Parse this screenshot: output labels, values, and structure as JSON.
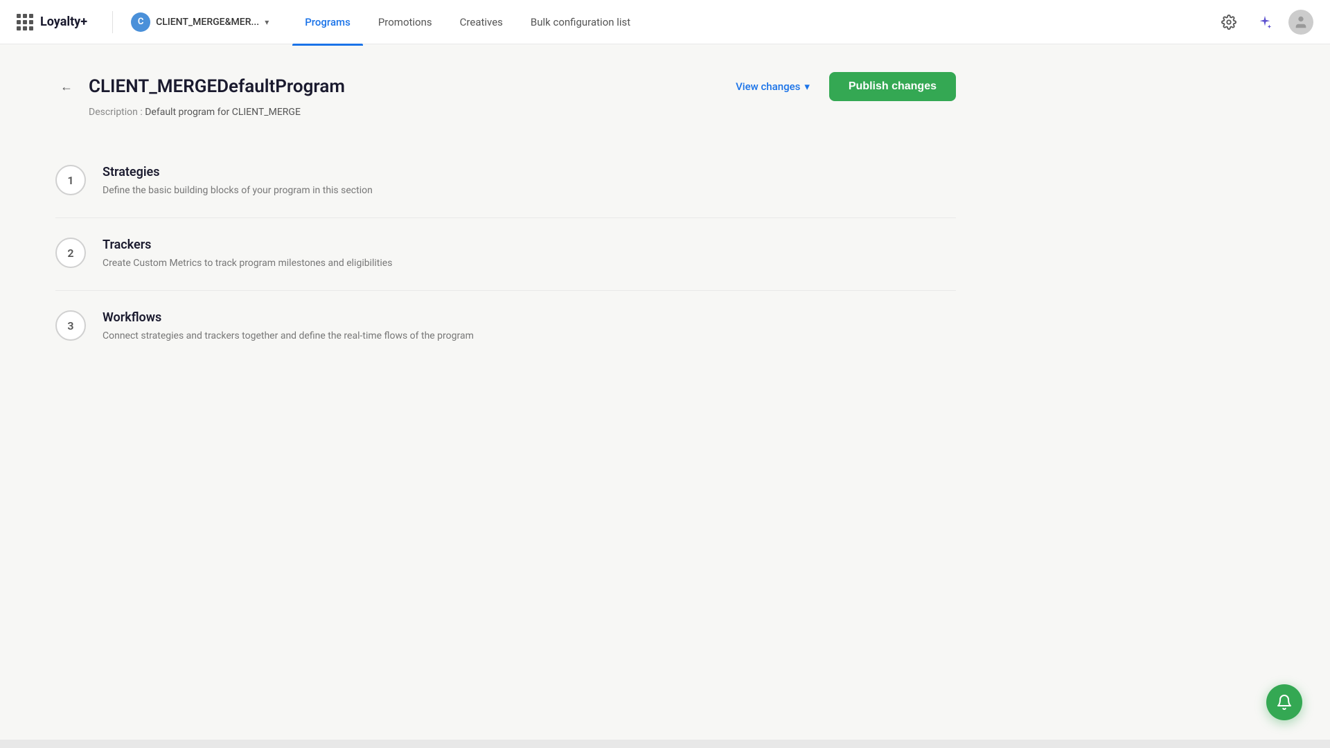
{
  "brand": {
    "name": "Loyalty+"
  },
  "client": {
    "initial": "C",
    "name": "CLIENT_MERGE&MER...",
    "avatar_color": "#4a90d9"
  },
  "nav": {
    "links": [
      {
        "label": "Programs",
        "active": true
      },
      {
        "label": "Promotions",
        "active": false
      },
      {
        "label": "Creatives",
        "active": false
      },
      {
        "label": "Bulk configuration list",
        "active": false
      }
    ]
  },
  "page": {
    "title": "CLIENT_MERGEDefaultProgram",
    "description_label": "Description :",
    "description_value": "Default program for CLIENT_MERGE"
  },
  "actions": {
    "view_changes": "View changes",
    "publish_changes": "Publish changes"
  },
  "sections": [
    {
      "number": "1",
      "title": "Strategies",
      "description": "Define the basic building blocks of your program in this section"
    },
    {
      "number": "2",
      "title": "Trackers",
      "description": "Create Custom Metrics to track program milestones and eligibilities"
    },
    {
      "number": "3",
      "title": "Workflows",
      "description": "Connect strategies and trackers together and define the real-time flows of the program"
    }
  ]
}
